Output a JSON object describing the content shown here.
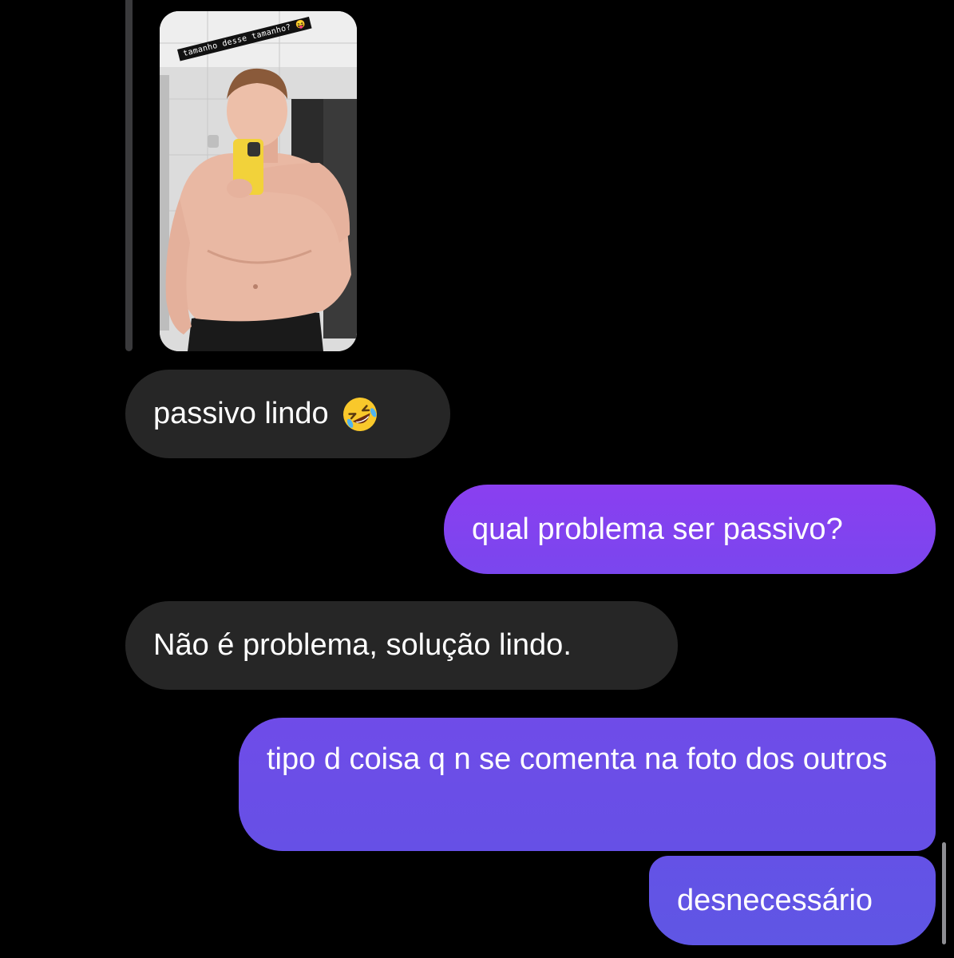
{
  "story": {
    "caption": "tamanho desse tamanho? 😝"
  },
  "messages": [
    {
      "direction": "received",
      "text": "passivo lindo",
      "emoji": "rolling-on-floor-laughing"
    },
    {
      "direction": "sent",
      "text": "qual problema ser passivo?"
    },
    {
      "direction": "received",
      "text": "Não é problema, solução lindo."
    },
    {
      "direction": "sent",
      "text": "tipo d coisa q n se comenta na foto dos outros"
    },
    {
      "direction": "sent",
      "text": "desnecessário"
    }
  ],
  "colors": {
    "background": "#000000",
    "received_bubble": "#262626",
    "sent_bubble_top": "#8a3ff0",
    "sent_bubble_bottom": "#5f56e4"
  }
}
